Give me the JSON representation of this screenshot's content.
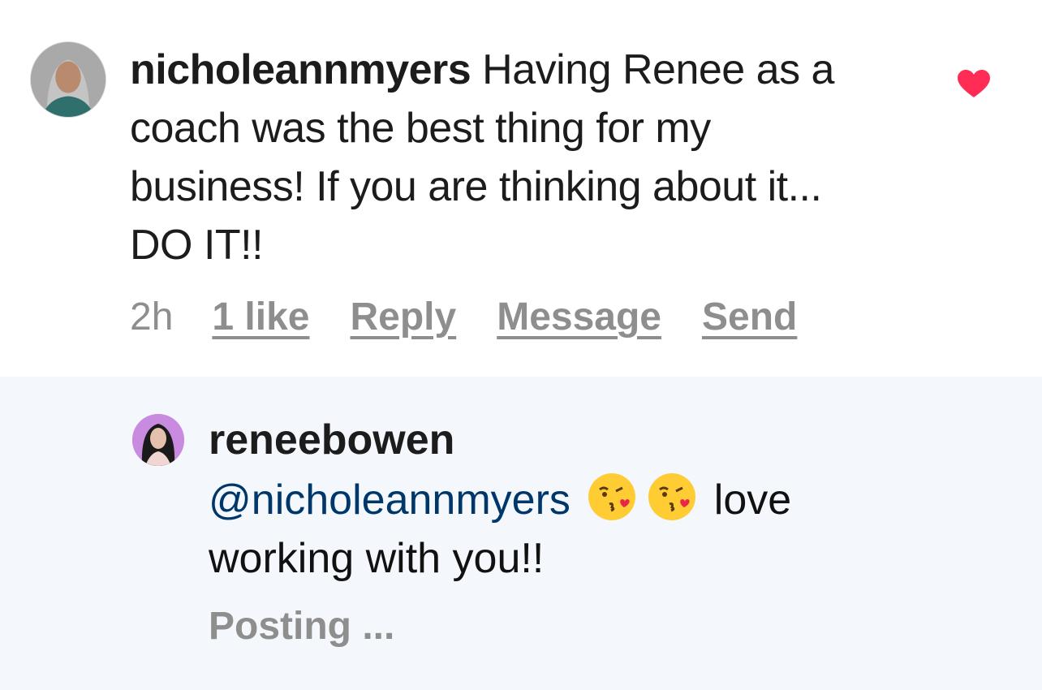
{
  "comment": {
    "username": "nicholeannmyers",
    "text": "Having Renee as a coach was the best thing for my business! If you are thinking about it... DO IT!!",
    "time": "2h",
    "likes": "1 like",
    "actions": {
      "reply": "Reply",
      "message": "Message",
      "send": "Send"
    },
    "liked": true,
    "heart_icon": "heart-icon",
    "heart_color": "#ff2d55"
  },
  "reply": {
    "username": "reneebowen",
    "mention": "@nicholeannmyers",
    "emojis": [
      "😘",
      "😘"
    ],
    "text": "love working with you!!",
    "status": "Posting ..."
  },
  "colors": {
    "reply_background": "#f4f8fc",
    "mention": "#00376b",
    "meta": "#8e8e8e"
  }
}
